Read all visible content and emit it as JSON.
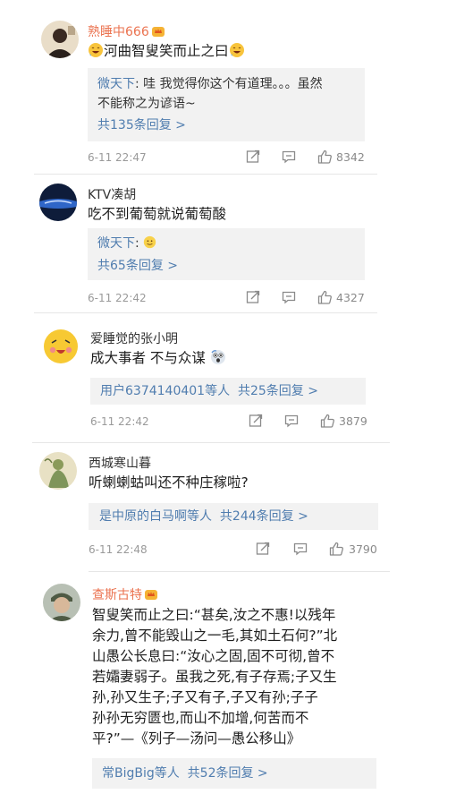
{
  "comments": [
    {
      "username": "熟睡中666",
      "vip": true,
      "text_main": "河曲智叟笑而止之曰",
      "reply_user": "微天下",
      "reply_text_1": ": 哇 我觉得你这个有道理。。。虽然",
      "reply_text_2": "不能称之为谚语~",
      "reply_count": "共135条回复 >",
      "time": "6-11 22:47",
      "likes": "8342"
    },
    {
      "username": "KTV凑胡",
      "vip": false,
      "text": "吃不到葡萄就说葡萄酸",
      "reply_user": "微天下",
      "reply_text_1": ":",
      "reply_count": "共65条回复 >",
      "time": "6-11 22:42",
      "likes": "4327"
    },
    {
      "username": "爱睡觉的张小明",
      "vip": false,
      "text": "成大事者 不与众谋",
      "reply_users": "用户6374140401等人",
      "reply_count": "共25条回复 >",
      "time": "6-11 22:42",
      "likes": "3879"
    },
    {
      "username": "西城寒山暮",
      "vip": false,
      "text": "听蝲蝲蛄叫还不种庄稼啦?",
      "reply_users": "是中原的白马啊等人",
      "reply_count": "共244条回复 >",
      "time": "6-11 22:48",
      "likes": "3790"
    },
    {
      "username": "查斯古特",
      "vip": true,
      "lines": [
        "智叟笑而止之曰:“甚矣,汝之不惠!以残年",
        "余力,曾不能毁山之一毛,其如土石何?”北",
        "山愚公长息曰:“汝心之固,固不可彻,曾不",
        "若孀妻弱子。虽我之死,有子存焉;子又生",
        "孙,孙又生子;子又有子,子又有孙;子子",
        "孙孙无穷匮也,而山不加增,何苦而不",
        "平?”—《列子—汤问—愚公移山》"
      ],
      "reply_users": "常BigBig等人",
      "reply_count": "共52条回复 >"
    }
  ],
  "icons": {
    "share": "share-icon",
    "comment": "comment-icon",
    "like": "thumbs-up-icon"
  },
  "colors": {
    "vip_name": "#eb7350",
    "link": "#507daf",
    "reply_bg": "#f2f2f2"
  }
}
